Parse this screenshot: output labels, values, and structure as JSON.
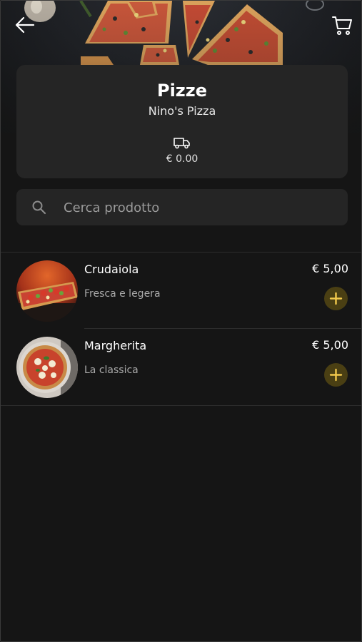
{
  "nav": {
    "back_icon": "arrow-left-icon",
    "cart_icon": "cart-icon"
  },
  "header": {
    "title": "Pizze",
    "subtitle": "Nino's Pizza",
    "delivery_icon": "truck-icon",
    "delivery_fee": "€ 0.00"
  },
  "search": {
    "placeholder": "Cerca prodotto",
    "value": "",
    "icon": "search-icon"
  },
  "products": [
    {
      "name": "Crudaiola",
      "description": "Fresca e legera",
      "price": "€ 5,00",
      "image": "pizza-crudaiola-image"
    },
    {
      "name": "Margherita",
      "description": "La classica",
      "price": "€ 5,00",
      "image": "pizza-margherita-image"
    }
  ],
  "colors": {
    "background": "#151515",
    "card": "#252525",
    "accent": "#f2c94c",
    "accent_bg": "#4a3f13",
    "muted_text": "#a9a9a9"
  }
}
